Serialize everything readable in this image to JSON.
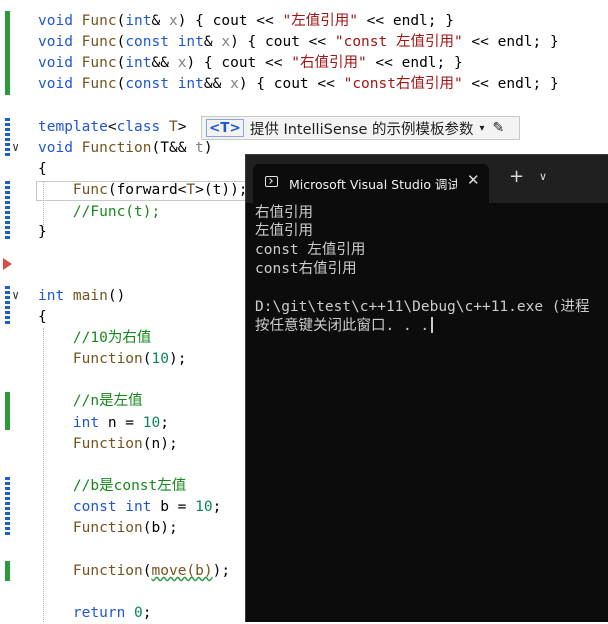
{
  "editor": {
    "lines": [
      {
        "key": "l1",
        "tokens": [
          {
            "t": "void ",
            "c": "kw"
          },
          {
            "t": "Func",
            "c": "fn"
          },
          {
            "t": "(",
            "c": ""
          },
          {
            "t": "int",
            "c": "kw"
          },
          {
            "t": "& ",
            "c": ""
          },
          {
            "t": "x",
            "c": "param"
          },
          {
            "t": ") { cout << ",
            "c": ""
          },
          {
            "t": "\"左值引用\"",
            "c": "str"
          },
          {
            "t": " << endl; }",
            "c": ""
          }
        ]
      },
      {
        "key": "l2",
        "tokens": [
          {
            "t": "void ",
            "c": "kw"
          },
          {
            "t": "Func",
            "c": "fn"
          },
          {
            "t": "(",
            "c": ""
          },
          {
            "t": "const int",
            "c": "kw"
          },
          {
            "t": "& ",
            "c": ""
          },
          {
            "t": "x",
            "c": "param"
          },
          {
            "t": ") { cout << ",
            "c": ""
          },
          {
            "t": "\"const 左值引用\"",
            "c": "str"
          },
          {
            "t": " << endl; }",
            "c": ""
          }
        ]
      },
      {
        "key": "l3",
        "tokens": [
          {
            "t": "void ",
            "c": "kw"
          },
          {
            "t": "Func",
            "c": "fn"
          },
          {
            "t": "(",
            "c": ""
          },
          {
            "t": "int",
            "c": "kw"
          },
          {
            "t": "&& ",
            "c": ""
          },
          {
            "t": "x",
            "c": "param"
          },
          {
            "t": ") { cout << ",
            "c": ""
          },
          {
            "t": "\"右值引用\"",
            "c": "str"
          },
          {
            "t": " << endl; }",
            "c": ""
          }
        ]
      },
      {
        "key": "l4",
        "tokens": [
          {
            "t": "void ",
            "c": "kw"
          },
          {
            "t": "Func",
            "c": "fn"
          },
          {
            "t": "(",
            "c": ""
          },
          {
            "t": "const int",
            "c": "kw"
          },
          {
            "t": "&& ",
            "c": ""
          },
          {
            "t": "x",
            "c": "param"
          },
          {
            "t": ") { cout << ",
            "c": ""
          },
          {
            "t": "\"const右值引用\"",
            "c": "str"
          },
          {
            "t": " << endl; }",
            "c": ""
          }
        ]
      },
      {
        "key": "l5",
        "tokens": [
          {
            "t": "template",
            "c": "kw"
          },
          {
            "t": "<",
            "c": ""
          },
          {
            "t": "class ",
            "c": "kw"
          },
          {
            "t": "T",
            "c": "fn"
          },
          {
            "t": ">",
            "c": ""
          }
        ]
      },
      {
        "key": "l6",
        "tokens": [
          {
            "t": "void ",
            "c": "kw"
          },
          {
            "t": "Function",
            "c": "fn"
          },
          {
            "t": "(T&& ",
            "c": ""
          },
          {
            "t": "t",
            "c": "param"
          },
          {
            "t": ")",
            "c": ""
          }
        ]
      },
      {
        "key": "l7",
        "tokens": [
          {
            "t": "{",
            "c": ""
          }
        ]
      },
      {
        "key": "l8",
        "tokens": [
          {
            "t": "    Func",
            "c": "fn"
          },
          {
            "t": "(forward<",
            "c": ""
          },
          {
            "t": "T",
            "c": "fn"
          },
          {
            "t": ">(t));",
            "c": ""
          }
        ]
      },
      {
        "key": "l9",
        "tokens": [
          {
            "t": "    //Func(t);",
            "c": "cmt"
          }
        ]
      },
      {
        "key": "l10",
        "tokens": [
          {
            "t": "}",
            "c": ""
          }
        ]
      },
      {
        "key": "l11",
        "tokens": [
          {
            "t": "int ",
            "c": "kw"
          },
          {
            "t": "main",
            "c": "fn"
          },
          {
            "t": "()",
            "c": ""
          }
        ]
      },
      {
        "key": "l12",
        "tokens": [
          {
            "t": "{",
            "c": ""
          }
        ]
      },
      {
        "key": "l13",
        "tokens": [
          {
            "t": "    //10为右值",
            "c": "cmt"
          }
        ]
      },
      {
        "key": "l14",
        "tokens": [
          {
            "t": "    Function",
            "c": "fn"
          },
          {
            "t": "(",
            "c": ""
          },
          {
            "t": "10",
            "c": "num"
          },
          {
            "t": ");",
            "c": ""
          }
        ]
      },
      {
        "key": "l15",
        "tokens": [
          {
            "t": "    //n是左值",
            "c": "cmt"
          }
        ]
      },
      {
        "key": "l16",
        "tokens": [
          {
            "t": "    int ",
            "c": "kw"
          },
          {
            "t": "n = ",
            "c": ""
          },
          {
            "t": "10",
            "c": "num"
          },
          {
            "t": ";",
            "c": ""
          }
        ]
      },
      {
        "key": "l17",
        "tokens": [
          {
            "t": "    Function",
            "c": "fn"
          },
          {
            "t": "(n);",
            "c": ""
          }
        ]
      },
      {
        "key": "l18",
        "tokens": [
          {
            "t": "    //b是const左值",
            "c": "cmt"
          }
        ]
      },
      {
        "key": "l19",
        "tokens": [
          {
            "t": "    const int ",
            "c": "kw"
          },
          {
            "t": "b = ",
            "c": ""
          },
          {
            "t": "10",
            "c": "num"
          },
          {
            "t": ";",
            "c": ""
          }
        ]
      },
      {
        "key": "l20",
        "tokens": [
          {
            "t": "    Function",
            "c": "fn"
          },
          {
            "t": "(b);",
            "c": ""
          }
        ]
      },
      {
        "key": "l21",
        "tokens": [
          {
            "t": "    Function",
            "c": "fn"
          },
          {
            "t": "(",
            "c": ""
          },
          {
            "t": "move(b)",
            "c": "fn squiggle"
          },
          {
            "t": ");",
            "c": ""
          }
        ]
      },
      {
        "key": "l22",
        "tokens": [
          {
            "t": "    return ",
            "c": "kw"
          },
          {
            "t": "0",
            "c": "num"
          },
          {
            "t": ";",
            "c": ""
          }
        ]
      }
    ],
    "template_hint": {
      "badge": "<T>",
      "text": "提供 IntelliSense 的示例模板参数",
      "caret": "▾",
      "pencil": "✎"
    },
    "fold_glyph": "∨"
  },
  "terminal": {
    "tab_title": "Microsoft Visual Studio 调试控",
    "close_glyph": "✕",
    "plus_glyph": "+",
    "dropdown_glyph": "∨",
    "output": [
      "右值引用",
      "左值引用",
      "const 左值引用",
      "const右值引用",
      "",
      "D:\\git\\test\\c++11\\Debug\\c++11.exe (进程",
      "按任意键关闭此窗口. . ."
    ]
  },
  "colors": {
    "keyword": "#1e56d6",
    "string": "#a31515",
    "comment": "#16891c",
    "function": "#74531f",
    "terminal_bg": "#0c0c0c"
  }
}
